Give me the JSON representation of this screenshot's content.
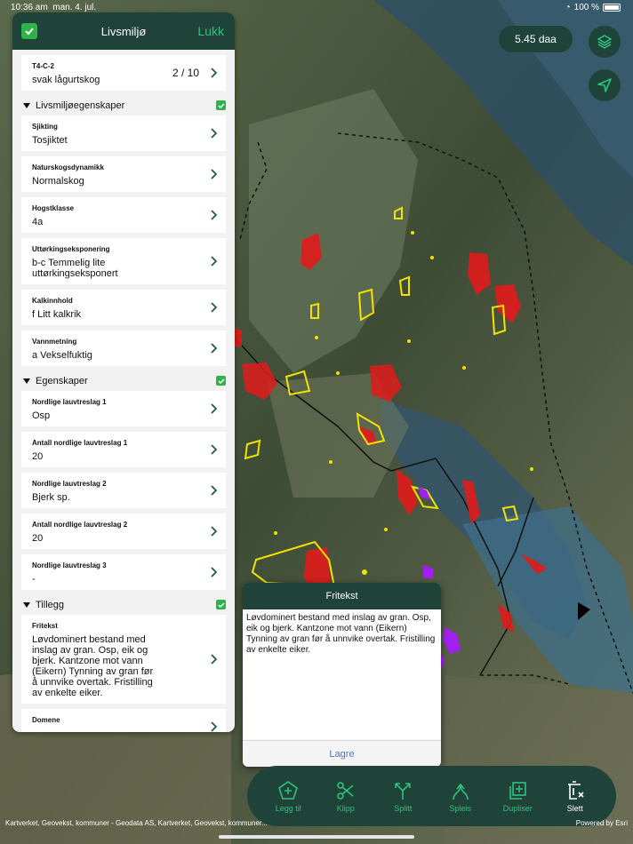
{
  "status": {
    "time": "10:36 am",
    "date": "man. 4. jul.",
    "battery": "100 %"
  },
  "panel": {
    "title": "Livsmiljø",
    "close_label": "Lukk",
    "top_field": {
      "label": "T4-C-2",
      "value": "svak lågurtskog",
      "counter": "2 / 10"
    },
    "sections": [
      {
        "title": "Livsmiljøegenskaper",
        "fields": [
          {
            "label": "Sjikting",
            "value": "Tosjiktet"
          },
          {
            "label": "Naturskogsdynamikk",
            "value": "Normalskog"
          },
          {
            "label": "Hogstklasse",
            "value": "4a"
          },
          {
            "label": "Uttørkingseksponering",
            "value": "b-c Temmelig lite uttørkingseksponert"
          },
          {
            "label": "Kalkinnhold",
            "value": "f Litt kalkrik"
          },
          {
            "label": "Vannmetning",
            "value": "a Vekselfuktig"
          }
        ]
      },
      {
        "title": "Egenskaper",
        "fields": [
          {
            "label": "Nordlige lauvtreslag 1",
            "value": "Osp"
          },
          {
            "label": "Antall nordlige lauvtreslag 1",
            "value": "20"
          },
          {
            "label": "Nordlige lauvtreslag 2",
            "value": "Bjerk sp."
          },
          {
            "label": "Antall nordlige lauvtreslag 2",
            "value": "20"
          },
          {
            "label": "Nordlige lauvtreslag 3",
            "value": "-"
          }
        ]
      },
      {
        "title": "Tillegg",
        "fields": [
          {
            "label": "Fritekst",
            "value": "Løvdominert bestand med inslag av gran. Osp, eik og bjerk. Kantzone mot vann (Eikern) Tynning av gran før å unnvike overtak. Fristilling av enkelte eiker."
          },
          {
            "label": "Domene",
            "value": "-"
          }
        ]
      }
    ]
  },
  "area": "5.45 daa",
  "popup": {
    "title": "Fritekst",
    "text": "Løvdominert bestand med inslag av gran. Osp, eik og bjerk. Kantzone mot vann (Eikern) Tynning av gran før å unnvike overtak. Fristilling av enkelte eiker.",
    "save_label": "Lagre"
  },
  "toolbar": {
    "add": "Legg til",
    "clip": "Klipp",
    "split": "Splitt",
    "splice": "Spleis",
    "duplicate": "Dupliser",
    "delete": "Slett"
  },
  "attribution": "Kartverket, Geovekst, kommuner - Geodata AS, Kartverket, Geovekst, kommuner...",
  "attribution_right": "Powered by Esri",
  "colors": {
    "header": "#1f4339",
    "accent": "#2ec27e",
    "check": "#2db34a"
  }
}
